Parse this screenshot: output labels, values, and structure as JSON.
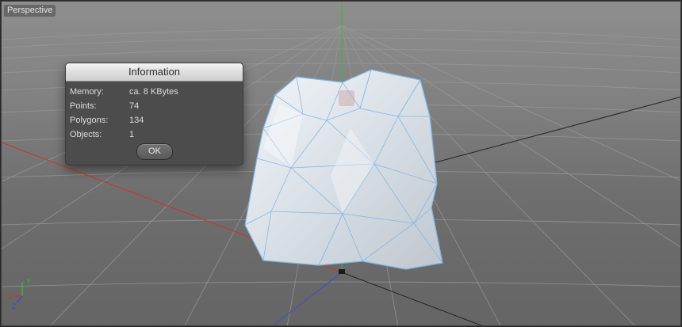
{
  "viewport": {
    "title": "Perspective"
  },
  "dialog": {
    "title": "Information",
    "rows": [
      {
        "label": "Memory:",
        "value": "ca. 8 KBytes"
      },
      {
        "label": "Points:",
        "value": "74"
      },
      {
        "label": "Polygons:",
        "value": "134"
      },
      {
        "label": "Objects:",
        "value": "1"
      }
    ],
    "ok_label": "OK"
  },
  "axis_gizmo": {
    "x_label": "X",
    "y_label": "Y",
    "z_label": "Z"
  },
  "colors": {
    "x_axis": "#d23030",
    "y_axis": "#2fbf2f",
    "z_axis": "#3a4fd0",
    "mesh_wire": "#7fb6e6",
    "mesh_fill": "#e9edf2"
  }
}
